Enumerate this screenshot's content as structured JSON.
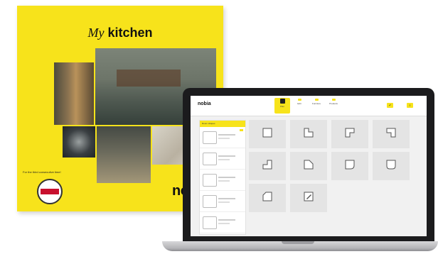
{
  "catalog": {
    "title_italic": "My",
    "title_bold": "kitchen",
    "badge_caption": "For the third consecutive time!",
    "brand": "nol"
  },
  "app": {
    "logo": "nobia",
    "nav": [
      {
        "label": "Plan",
        "icon": "plan-icon",
        "active": true
      },
      {
        "label": "Edit",
        "icon": "edit-icon",
        "active": false
      },
      {
        "label": "Furniture",
        "icon": "furniture-icon",
        "active": false
      },
      {
        "label": "Products",
        "icon": "products-icon",
        "active": false
      }
    ],
    "sidebar": {
      "header": "Room shapes",
      "items": [
        "",
        "",
        "",
        "",
        ""
      ]
    },
    "shapes": [
      {
        "name": "square-room-icon"
      },
      {
        "name": "l-room-icon"
      },
      {
        "name": "notch-room-icon"
      },
      {
        "name": "corner-room-icon"
      },
      {
        "name": "step-room-icon"
      },
      {
        "name": "angled-room-icon"
      },
      {
        "name": "curve-room-icon"
      },
      {
        "name": "rounded-room-icon"
      },
      {
        "name": "chamfer-room-icon"
      },
      {
        "name": "custom-draw-icon"
      }
    ]
  },
  "colors": {
    "accent": "#f7e31b",
    "laptop": "#1b1b1d"
  }
}
